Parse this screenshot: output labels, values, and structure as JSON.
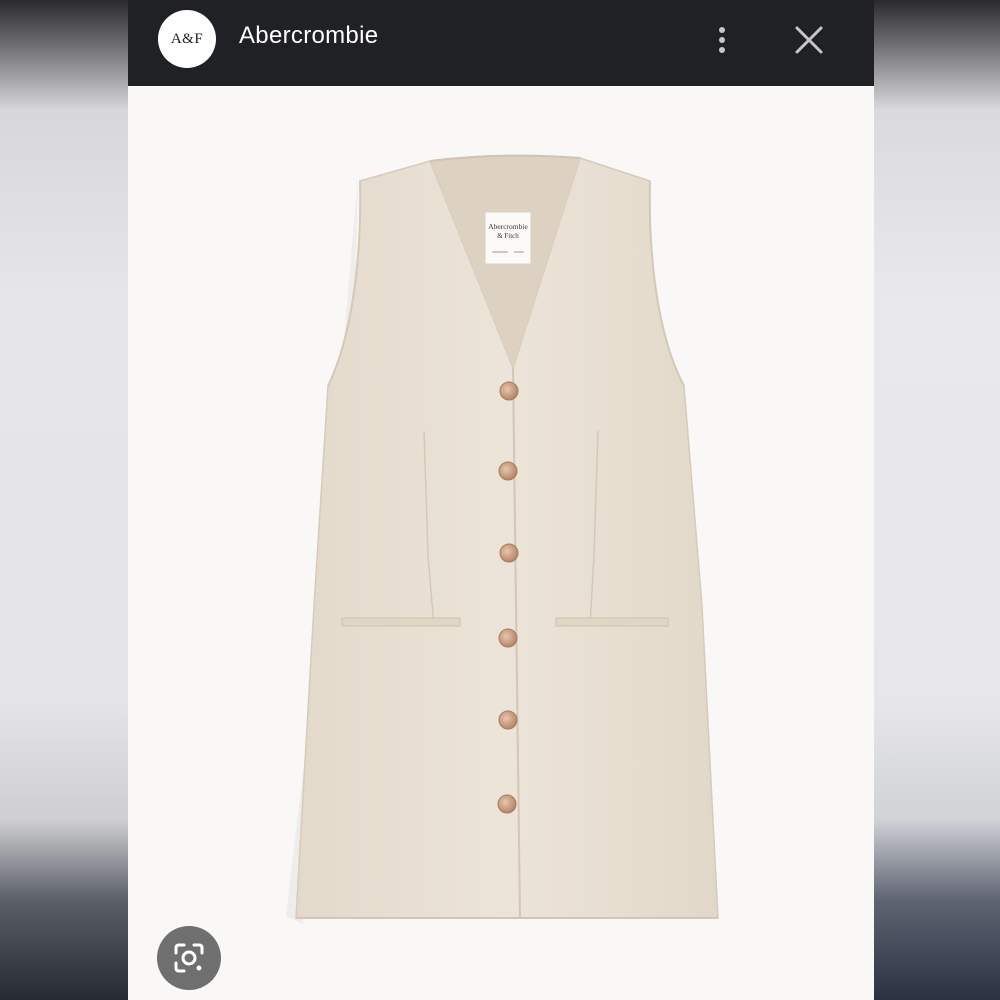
{
  "header": {
    "logo_text": "A&F",
    "title": "Abercrombie"
  },
  "icons": {
    "more": "more-vert-icon",
    "close": "close-icon",
    "lens": "google-lens-icon"
  },
  "product_image": {
    "label_line1": "Abercrombie",
    "label_line2": "& Fitch"
  },
  "colors": {
    "topbar": "#202124",
    "fabric": "#e9e0d3",
    "button": "#c99e84"
  }
}
